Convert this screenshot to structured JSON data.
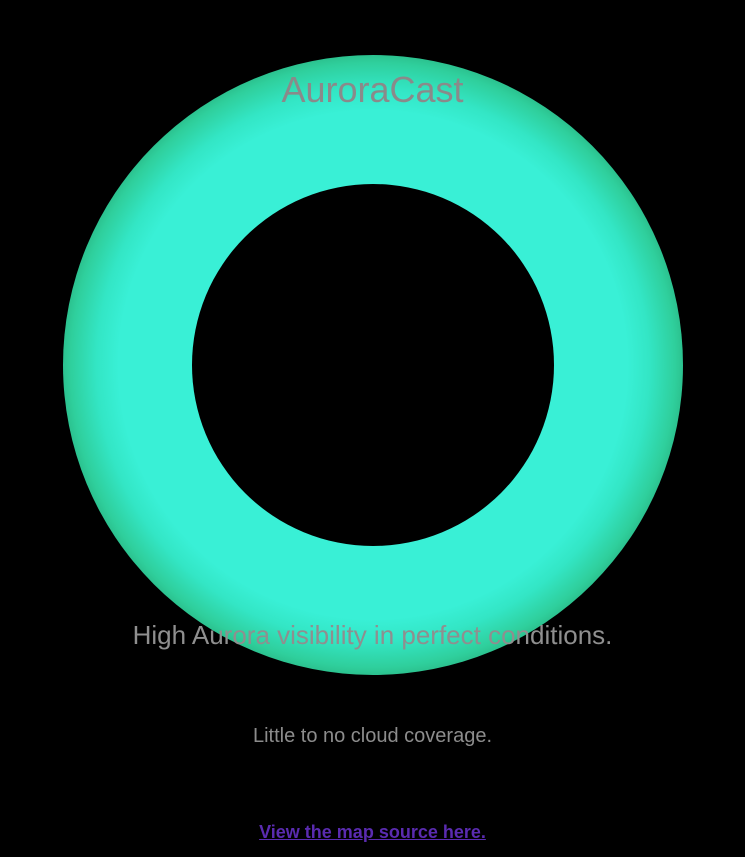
{
  "app": {
    "title": "AuroraCast"
  },
  "forecast": {
    "headline": "High Aurora visibility in perfect conditions.",
    "cloud_note": "Little to no cloud coverage."
  },
  "links": {
    "map_source_label": "View the map source here."
  },
  "colors": {
    "background": "#000000",
    "aurora_glow": "#39f0d6",
    "text": "#8a8a8a",
    "link": "#5a2bb0"
  }
}
